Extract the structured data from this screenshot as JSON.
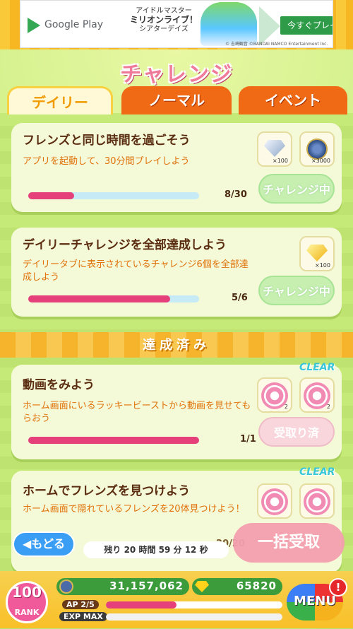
{
  "ad": {
    "store": "Google Play",
    "title_line1": "アイドルマスター",
    "title_line2": "ミリオンライブ！",
    "title_line3": "シアターデイズ",
    "cta": "今すぐプレイ",
    "copyright": "© 吉崎観音 ©BANDAI NAMCO Entertainment Inc."
  },
  "header": {
    "title": "チャレンジ"
  },
  "tabs": [
    {
      "label": "デイリー",
      "active": true
    },
    {
      "label": "ノーマル",
      "active": false
    },
    {
      "label": "イベント",
      "active": false
    }
  ],
  "challenges": [
    {
      "title": "フレンズと同じ時間を過ごそう",
      "desc": "アプリを起動して、30分間プレイしよう",
      "progress": "8/30",
      "progress_fraction": 0.27,
      "rewards": [
        {
          "icon": "silver-gem-icon",
          "count": "×100"
        },
        {
          "icon": "coin-icon",
          "count": "×3000"
        }
      ],
      "button": "チャレンジ中"
    },
    {
      "title": "デイリーチャレンジを全部達成しよう",
      "desc": "デイリータブに表示されているチャレンジ6個を全部達成しよう",
      "progress": "5/6",
      "progress_fraction": 0.83,
      "rewards": [
        {
          "icon": "gold-gem-icon",
          "count": "×100"
        }
      ],
      "button": "チャレンジ中"
    }
  ],
  "completed_section": {
    "label": "達成済み"
  },
  "completed": [
    {
      "badge": "CLEAR",
      "title": "動画をみよう",
      "desc": "ホーム画面にいるラッキービーストから動画を見せてもらおう",
      "progress": "1/1",
      "progress_fraction": 1.0,
      "rewards": [
        {
          "icon": "lucky-icon",
          "count": "2"
        },
        {
          "icon": "lucky-icon",
          "count": "2"
        }
      ],
      "button": "受取り済"
    },
    {
      "badge": "CLEAR",
      "title": "ホームでフレンズを見つけよう",
      "desc": "ホーム画面で隠れているフレンズを20体見つけよう！",
      "progress": "20/20",
      "rewards": [
        {
          "icon": "lucky-icon",
          "count": ""
        },
        {
          "icon": "lucky-icon",
          "count": ""
        }
      ]
    }
  ],
  "footer": {
    "back": "もどる",
    "timer": "残り 20 時間 59 分 12 秒",
    "bulk": "一括受取",
    "rank_num": "100",
    "rank_label": "RANK",
    "coins": "31,157,062",
    "gems": "65820",
    "ap_label": "AP 2/5",
    "ap_fraction": 0.4,
    "exp_label": "EXP MAX",
    "menu": "MENU",
    "alert": "!"
  }
}
